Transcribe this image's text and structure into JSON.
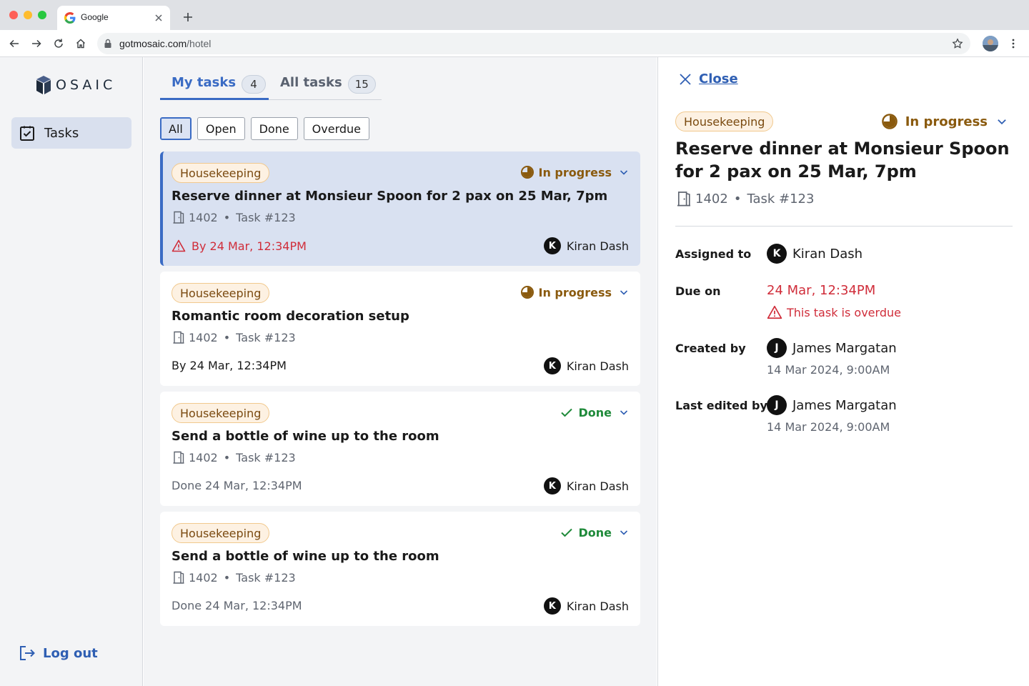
{
  "browser": {
    "tab_title": "Google",
    "url_host": "gotmosaic.com",
    "url_path": "/hotel"
  },
  "app": {
    "logo_text": "OSAIC",
    "nav_tasks": "Tasks",
    "logout": "Log out"
  },
  "tabs": [
    {
      "label": "My tasks",
      "count": "4"
    },
    {
      "label": "All tasks",
      "count": "15"
    }
  ],
  "filters": [
    "All",
    "Open",
    "Done",
    "Overdue"
  ],
  "tasks": [
    {
      "category": "Housekeeping",
      "status": "In progress",
      "title": "Reserve dinner at Monsieur Spoon for 2 pax on 25 Mar, 7pm",
      "room": "1402",
      "task_no": "Task #123",
      "due": "By 24 Mar, 12:34PM",
      "assignee_initial": "K",
      "assignee": "Kiran Dash"
    },
    {
      "category": "Housekeeping",
      "status": "In progress",
      "title": "Romantic room decoration setup",
      "room": "1402",
      "task_no": "Task #123",
      "due": "By 24 Mar, 12:34PM",
      "assignee_initial": "K",
      "assignee": "Kiran Dash"
    },
    {
      "category": "Housekeeping",
      "status": "Done",
      "title": "Send a bottle of wine up to the room",
      "room": "1402",
      "task_no": "Task #123",
      "due": "Done 24 Mar, 12:34PM",
      "assignee_initial": "K",
      "assignee": "Kiran Dash"
    },
    {
      "category": "Housekeeping",
      "status": "Done",
      "title": "Send a bottle of wine up to the room",
      "room": "1402",
      "task_no": "Task #123",
      "due": "Done 24 Mar, 12:34PM",
      "assignee_initial": "K",
      "assignee": "Kiran Dash"
    }
  ],
  "detail": {
    "close": "Close",
    "category": "Housekeeping",
    "status": "In progress",
    "title": "Reserve dinner at Monsieur Spoon for 2 pax on 25 Mar, 7pm",
    "room": "1402",
    "task_no": "Task #123",
    "assigned_label": "Assigned to",
    "assigned_initial": "K",
    "assigned_name": "Kiran Dash",
    "due_label": "Due on",
    "due_value": "24 Mar, 12:34PM",
    "overdue_note": "This task is overdue",
    "created_label": "Created by",
    "created_initial": "J",
    "created_name": "James Margatan",
    "created_time": "14 Mar 2024, 9:00AM",
    "edited_label": "Last edited by",
    "edited_initial": "J",
    "edited_name": "James Margatan",
    "edited_time": "14 Mar 2024, 9:00AM"
  },
  "colors": {
    "accent": "#3a6bc4",
    "overdue": "#d02d3a",
    "in_progress": "#8a5a0e",
    "done": "#1f8a3a",
    "badge_bg": "#fdf1e2"
  }
}
